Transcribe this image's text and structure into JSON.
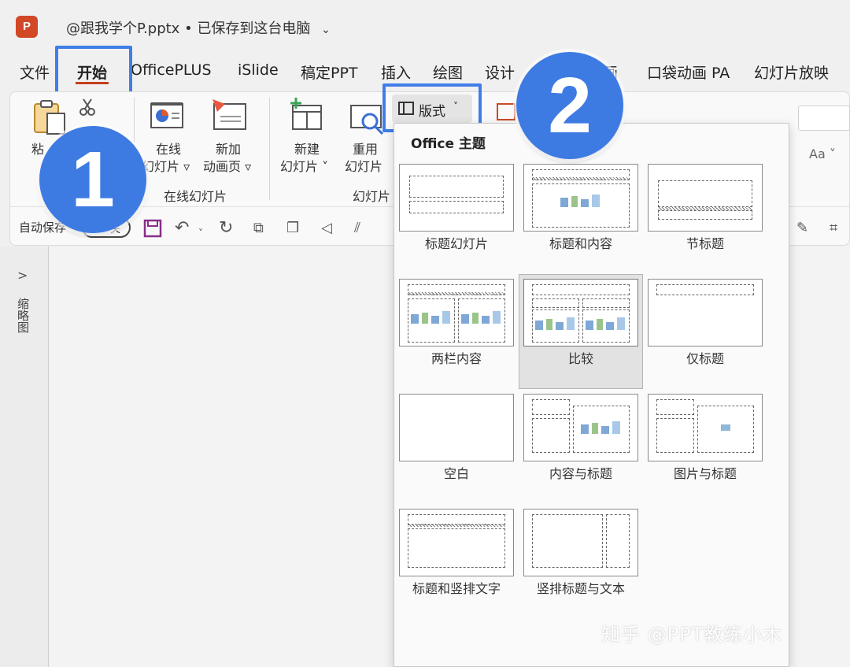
{
  "titlebar": {
    "app_icon": "P",
    "doc_name": "@跟我学个P.pptx",
    "separator": "•",
    "save_status": "已保存到这台电脑"
  },
  "tabs": [
    "文件",
    "开始",
    "OfficePLUS",
    "iSlide",
    "稿定PPT",
    "插入",
    "绘图",
    "设计",
    "画",
    "口袋动画 PA",
    "幻灯片放映"
  ],
  "ribbon": {
    "paste_label": "粘",
    "online_slide_line1": "在线",
    "online_slide_line2": "幻灯片",
    "new_anim_line1": "新加",
    "new_anim_line2": "动画页",
    "group_online": "在线幻灯片",
    "new_slide_line1": "新建",
    "new_slide_line2": "幻灯片",
    "reuse_line1": "重用",
    "reuse_line2": "幻灯片",
    "group_slides": "幻灯片",
    "layout_button": "版式",
    "font_aa": "Aa"
  },
  "quickbar": {
    "autosave_label": "自动保存",
    "toggle_state": "关"
  },
  "left_panel": {
    "expand": ">",
    "label": "缩略图"
  },
  "callouts": {
    "one": "1",
    "two": "2"
  },
  "dropdown": {
    "heading": "Office 主题",
    "layouts": [
      "标题幻灯片",
      "标题和内容",
      "节标题",
      "两栏内容",
      "比较",
      "仅标题",
      "空白",
      "内容与标题",
      "图片与标题",
      "标题和竖排文字",
      "竖排标题与文本"
    ],
    "selected": "比较"
  },
  "watermark": "知乎 @PPT教练小木",
  "colors": {
    "highlight": "#3f7ee8",
    "callout": "#3d7be3",
    "accent": "#c43e1c"
  }
}
